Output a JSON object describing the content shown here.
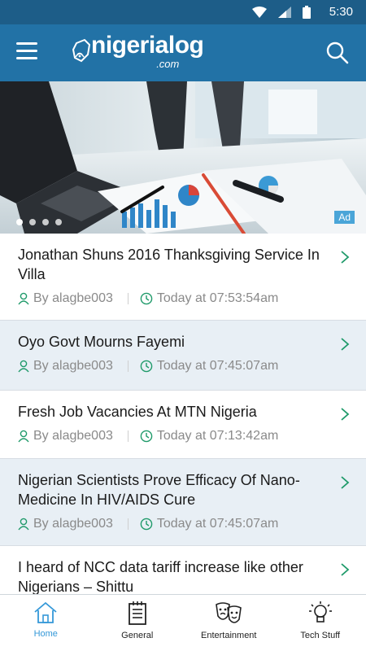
{
  "status_bar": {
    "time": "5:30",
    "icons": [
      "wifi-icon",
      "signal-icon",
      "battery-icon"
    ]
  },
  "app_bar": {
    "logo_name": "nigerialog",
    "logo_sub": ".com",
    "menu_icon": "hamburger-menu-icon",
    "search_icon": "search-icon"
  },
  "hero": {
    "ad_label": "Ad",
    "slides_count": 4,
    "active_slide": 1
  },
  "articles": [
    {
      "title": "Jonathan Shuns 2016 Thanksgiving Service In Villa",
      "author": "By alagbe003",
      "time": "Today at 07:53:54am"
    },
    {
      "title": "Oyo Govt Mourns Fayemi",
      "author": "By alagbe003",
      "time": "Today at 07:45:07am"
    },
    {
      "title": "Fresh Job Vacancies At MTN Nigeria",
      "author": "By alagbe003",
      "time": "Today at 07:13:42am"
    },
    {
      "title": "Nigerian Scientists Prove Efficacy Of Nano-Medicine In HIV/AIDS Cure",
      "author": "By alagbe003",
      "time": "Today at 07:45:07am"
    },
    {
      "title": "I heard of NCC data tariff increase like other Nigerians – Shittu",
      "author": "",
      "time": ""
    }
  ],
  "bottom_nav": [
    {
      "label": "Home",
      "icon": "home-icon",
      "active": true
    },
    {
      "label": "General",
      "icon": "document-icon",
      "active": false
    },
    {
      "label": "Entertainment",
      "icon": "theater-masks-icon",
      "active": false
    },
    {
      "label": "Tech Stuff",
      "icon": "lightbulb-icon",
      "active": false
    }
  ],
  "colors": {
    "status_bar": "#1d5d88",
    "app_bar": "#2272a6",
    "alt_row": "#e8eff5",
    "accent": "#3498d8",
    "meta_icon": "#1f9a6a"
  }
}
